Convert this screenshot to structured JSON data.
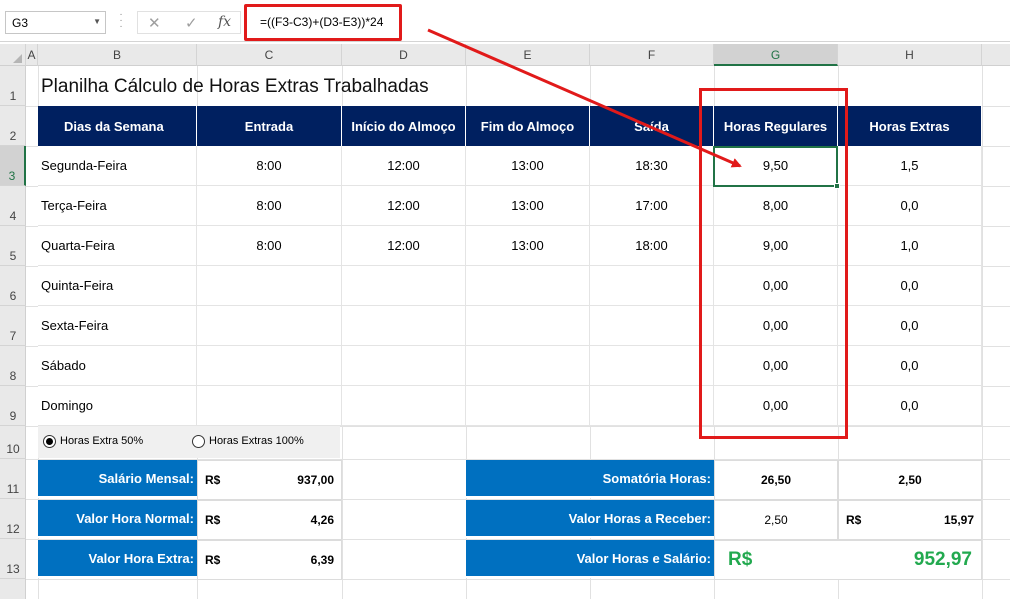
{
  "formula_bar": {
    "name_box": "G3",
    "formula": "=((F3-C3)+(D3-E3))*24",
    "fx_label": "fx"
  },
  "columns": [
    "A",
    "B",
    "C",
    "D",
    "E",
    "F",
    "G",
    "H"
  ],
  "rows": [
    "1",
    "2",
    "3",
    "4",
    "5",
    "6",
    "7",
    "8",
    "9",
    "10",
    "11",
    "12",
    "13"
  ],
  "sheet": {
    "title": "Planilha Cálculo de Horas Extras Trabalhadas",
    "headers": [
      "Dias da Semana",
      "Entrada",
      "Início do Almoço",
      "Fim do Almoço",
      "Saída",
      "Horas Regulares",
      "Horas Extras"
    ],
    "table": [
      [
        "Segunda-Feira",
        "8:00",
        "12:00",
        "13:00",
        "18:30",
        "9,50",
        "1,5"
      ],
      [
        "Terça-Feira",
        "8:00",
        "12:00",
        "13:00",
        "17:00",
        "8,00",
        "0,0"
      ],
      [
        "Quarta-Feira",
        "8:00",
        "12:00",
        "13:00",
        "18:00",
        "9,00",
        "1,0"
      ],
      [
        "Quinta-Feira",
        "",
        "",
        "",
        "",
        "0,00",
        "0,0"
      ],
      [
        "Sexta-Feira",
        "",
        "",
        "",
        "",
        "0,00",
        "0,0"
      ],
      [
        "Sábado",
        "",
        "",
        "",
        "",
        "0,00",
        "0,0"
      ],
      [
        "Domingo",
        "",
        "",
        "",
        "",
        "0,00",
        "0,0"
      ]
    ],
    "options": {
      "opt1": "Horas Extra 50%",
      "opt2": "Horas Extras 100%",
      "selected": "opt1"
    },
    "salary": {
      "salario_mensal_label": "Salário Mensal:",
      "salario_mensal_cur": "R$",
      "salario_mensal_val": "937,00",
      "valor_hora_normal_label": "Valor Hora Normal:",
      "valor_hora_normal_cur": "R$",
      "valor_hora_normal_val": "4,26",
      "valor_hora_extra_label": "Valor Hora Extra:",
      "valor_hora_extra_cur": "R$",
      "valor_hora_extra_val": "6,39"
    },
    "totals": {
      "somatoria_label": "Somatória Horas:",
      "somatoria_regulares": "26,50",
      "somatoria_extras": "2,50",
      "valor_receber_label": "Valor Horas a Receber:",
      "valor_receber_horas": "2,50",
      "valor_receber_cur": "R$",
      "valor_receber_val": "15,97",
      "valor_salario_label": "Valor Horas e Salário:",
      "valor_salario_cur": "R$",
      "valor_salario_val": "952,97"
    }
  },
  "colors": {
    "header_navy": "#002060",
    "summary_blue": "#0070c0",
    "excel_green": "#217346",
    "highlight_red": "#e11a1a",
    "total_green": "#22a94f"
  }
}
